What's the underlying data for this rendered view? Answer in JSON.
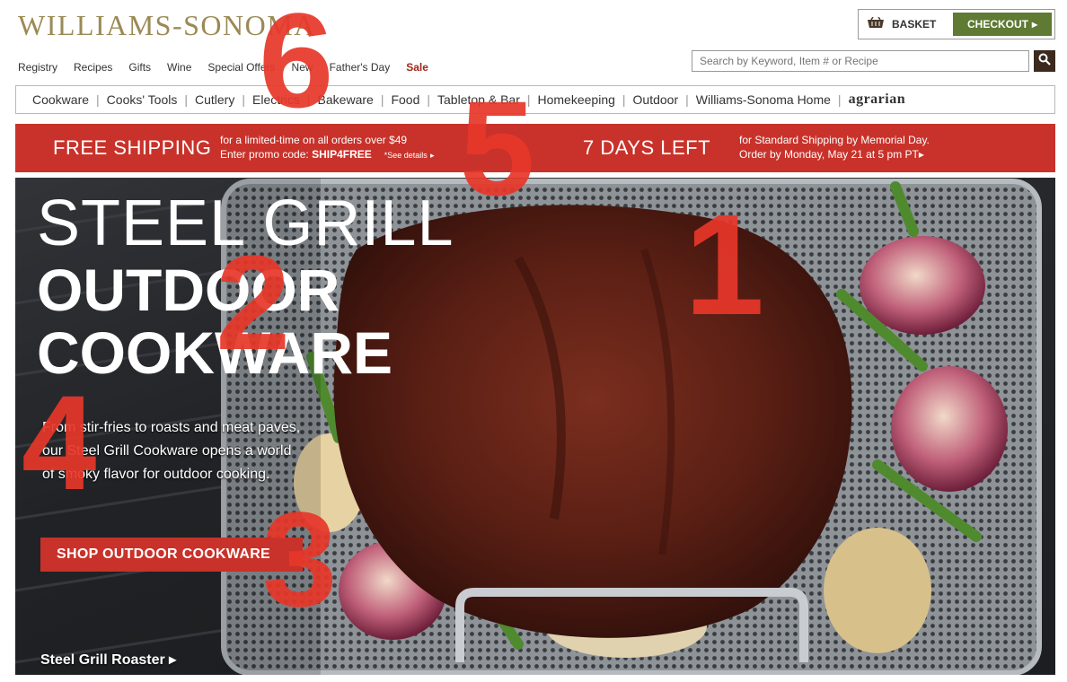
{
  "header": {
    "logo": "WILLIAMS-SONOMA",
    "basket_label": "BASKET",
    "checkout_label": "CHECKOUT"
  },
  "utility_nav": [
    "Registry",
    "Recipes",
    "Gifts",
    "Wine",
    "Special Offers",
    "New",
    "Father's Day",
    "Sale"
  ],
  "search": {
    "placeholder": "Search by Keyword, Item # or Recipe"
  },
  "categories": [
    "Cookware",
    "Cooks' Tools",
    "Cutlery",
    "Electrics",
    "Bakeware",
    "Food",
    "Tabletop & Bar",
    "Homekeeping",
    "Outdoor",
    "Williams-Sonoma Home",
    "agrarian"
  ],
  "promo": {
    "title": "FREE SHIPPING",
    "line1": "for a limited-time on all orders over $49",
    "line2_prefix": "Enter promo code: ",
    "code": "SHIP4FREE",
    "details": "*See details",
    "days_left": "7 DAYS LEFT",
    "note1": "for Standard Shipping by Memorial Day.",
    "note2": "Order by Monday, May 21 at 5 pm PT"
  },
  "hero": {
    "line1": "STEEL GRILL",
    "line2": "OUTDOOR",
    "line3": "COOKWARE",
    "description": "From stir-fries to roasts and meat paves, our Steel Grill Cookware opens a world of smoky flavor for outdoor cooking.",
    "cta": "SHOP OUTDOOR COOKWARE",
    "product_link": "Steel Grill Roaster"
  },
  "overlay_numbers": [
    "1",
    "2",
    "3",
    "4",
    "5",
    "6"
  ],
  "colors": {
    "brand_gold": "#9a8a55",
    "promo_red": "#c8322a",
    "checkout_green": "#5e7a33",
    "overlay_red": "#e8372a"
  }
}
